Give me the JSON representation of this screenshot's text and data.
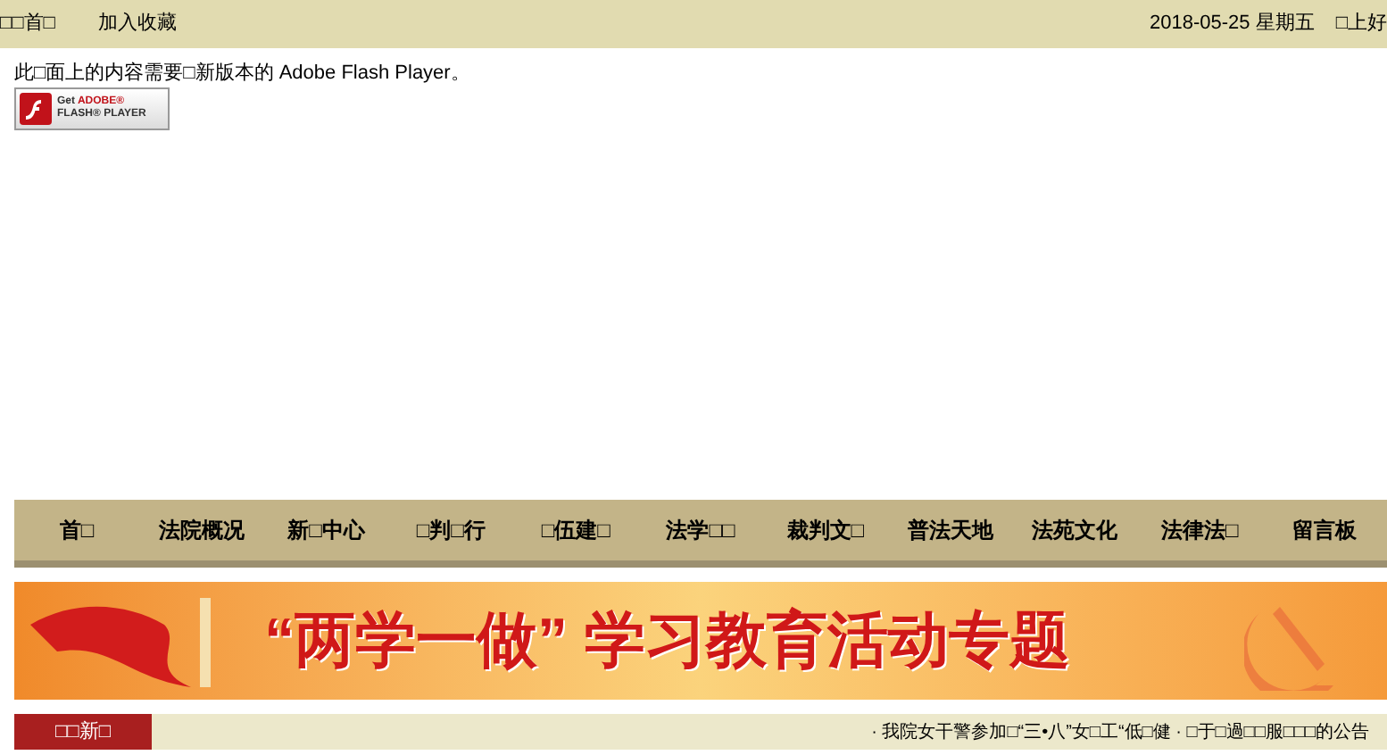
{
  "top_bar": {
    "links": [
      "□□首□",
      "加入收藏"
    ],
    "date": "2018-05-25 星期五",
    "greeting": "□上好"
  },
  "flash_notice": {
    "message": "此□面上的内容需要□新版本的 Adobe Flash Player。",
    "button_line1_prefix": "Get ",
    "button_line1_brand": "ADOBE®",
    "button_line2": "FLASH® PLAYER"
  },
  "nav": {
    "items": [
      "首□",
      "法院概况",
      "新□中心",
      "□判□行",
      "□伍建□",
      "法学□□",
      "裁判文□",
      "普法天地",
      "法苑文化",
      "法律法□",
      "留言板"
    ]
  },
  "banner": {
    "title": "“两学一做” 学习教育活动专题"
  },
  "news_ticker": {
    "label": "□□新□",
    "headline": "· 我院女干警参加□“三•八”女□工“低□健 · □于□過□□服□□□的公告"
  }
}
